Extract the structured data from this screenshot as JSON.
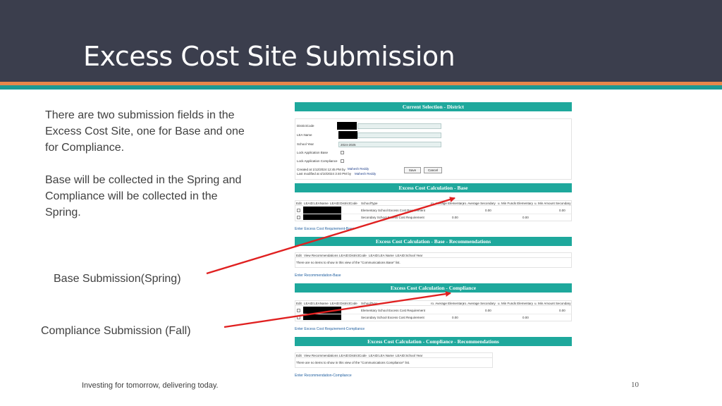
{
  "slide": {
    "title": "Excess Cost Site Submission",
    "para1": "There are two submission fields in the Excess Cost Site, one for Base and one for Compliance.",
    "para2": "Base will be collected in the Spring and Compliance will be collected in the Spring.",
    "label_base": "Base Submission(Spring)",
    "label_compliance": "Compliance Submission (Fall)",
    "footer": "Investing for tomorrow, delivering today.",
    "page_number": "10"
  },
  "colors": {
    "header_bg": "#3b3e4d",
    "stripe_orange": "#e8874a",
    "stripe_teal": "#1c9a94",
    "section_bar": "#1ea89c",
    "arrow": "#e02020"
  },
  "current_selection": {
    "header": "Current Selection - District",
    "district_code_label": "DistrictCode",
    "lea_name_label": "LEA Name",
    "school_year_label": "School Year",
    "school_year_value": "2024-2025",
    "lock_base_label": "Lock Application Base",
    "lock_compliance_label": "Lock Application Compliance",
    "created_text": "Created at 1/12/2024 12:45 PM  by",
    "created_by": "Mahesh Reddy",
    "modified_text": "Last modified at 4/10/2024 3:40 PM  by",
    "modified_by": "Mahesh Reddy",
    "save_label": "Save",
    "cancel_label": "Cancel"
  },
  "base": {
    "header": "Excess Cost Calculation - Base",
    "columns": [
      "Edit",
      "LEAID:LEAName",
      "LEAID:DistrictCode",
      "SchoolType",
      "ro. Average Elementary",
      "ro. Average Secondary",
      "u. Min Funds Elementary",
      "u. Min Amount Secondary"
    ],
    "rows": [
      {
        "type": "Elementary School Excess Cost Requirement",
        "v1": "0.00",
        "v2": "0.00"
      },
      {
        "type": "Secondary School Excess Cost Requirement",
        "v1": "0.00",
        "v2": "0.00"
      }
    ],
    "link": "Enter Excess Cost Requirement-Base"
  },
  "base_recs": {
    "header": "Excess Cost Calculation - Base - Recommendations",
    "columns": [
      "Edit",
      "View Recommendations",
      "LEAID:DistrictCode",
      "LEAID:LEA Name",
      "LEAID:School Year"
    ],
    "empty": "There are no items to show in this view of the \"Communications Base\" list.",
    "link": "Enter Recommendation-Base"
  },
  "compliance": {
    "header": "Excess Cost Calculation - Compliance",
    "columns": [
      "Edit",
      "LEAID:LEAName",
      "LEAID:DistrictCode",
      "SchoolType",
      "ro. Average Elementary",
      "ro. Average Secondary",
      "u. Min Funds Elementary",
      "u. Min Amount Secondary"
    ],
    "rows": [
      {
        "type": "Elementary School Excess Cost Requirement",
        "v1": "0.00",
        "v2": "0.00"
      },
      {
        "type": "Secondary School Excess Cost Requirement",
        "v1": "0.00",
        "v2": "0.00"
      }
    ],
    "link": "Enter Excess Cost Requirement-Compliance"
  },
  "compliance_recs": {
    "header": "Excess Cost Calculation - Compliance - Recommendations",
    "columns": [
      "Edit",
      "View Recommendations",
      "LEAID:DistrictCode",
      "LEAID:LEA Name",
      "LEAID:School Year"
    ],
    "empty": "There are no items to show in this view of the \"Communications Compliance\" list.",
    "link": "Enter Recommendation-Compliance"
  }
}
